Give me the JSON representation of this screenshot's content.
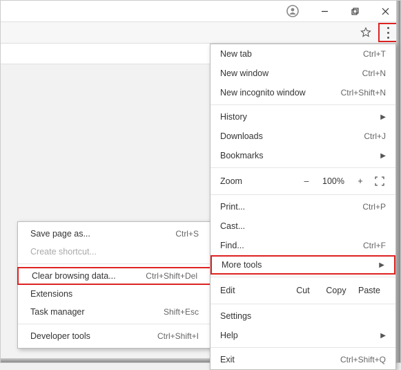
{
  "window_controls": {
    "minimize": "–",
    "maximize": "❐",
    "close": "✕"
  },
  "main_menu": {
    "new_tab": {
      "label": "New tab",
      "shortcut": "Ctrl+T"
    },
    "new_window": {
      "label": "New window",
      "shortcut": "Ctrl+N"
    },
    "new_incognito": {
      "label": "New incognito window",
      "shortcut": "Ctrl+Shift+N"
    },
    "history": {
      "label": "History"
    },
    "downloads": {
      "label": "Downloads",
      "shortcut": "Ctrl+J"
    },
    "bookmarks": {
      "label": "Bookmarks"
    },
    "zoom": {
      "label": "Zoom",
      "minus": "–",
      "pct": "100%",
      "plus": "+"
    },
    "print": {
      "label": "Print...",
      "shortcut": "Ctrl+P"
    },
    "cast": {
      "label": "Cast..."
    },
    "find": {
      "label": "Find...",
      "shortcut": "Ctrl+F"
    },
    "more_tools": {
      "label": "More tools"
    },
    "edit": {
      "label": "Edit",
      "cut": "Cut",
      "copy": "Copy",
      "paste": "Paste"
    },
    "settings": {
      "label": "Settings"
    },
    "help": {
      "label": "Help"
    },
    "exit": {
      "label": "Exit",
      "shortcut": "Ctrl+Shift+Q"
    }
  },
  "sub_menu": {
    "save_page": {
      "label": "Save page as...",
      "shortcut": "Ctrl+S"
    },
    "create_shortcut": {
      "label": "Create shortcut..."
    },
    "clear_data": {
      "label": "Clear browsing data...",
      "shortcut": "Ctrl+Shift+Del"
    },
    "extensions": {
      "label": "Extensions"
    },
    "task_manager": {
      "label": "Task manager",
      "shortcut": "Shift+Esc"
    },
    "dev_tools": {
      "label": "Developer tools",
      "shortcut": "Ctrl+Shift+I"
    }
  }
}
